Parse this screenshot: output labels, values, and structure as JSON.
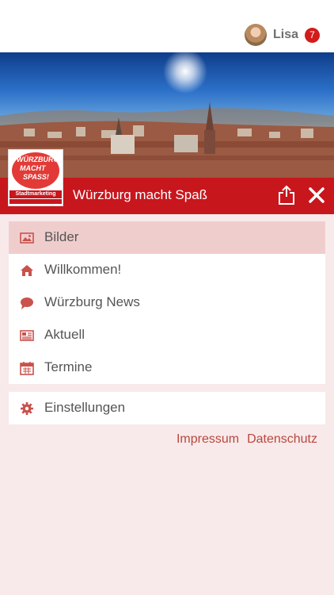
{
  "user": {
    "name": "Lisa",
    "notifications": "7"
  },
  "banner": {
    "title": "Würzburg macht Spaß"
  },
  "logo": {
    "lines": [
      "WÜRZBURG",
      "MACHT",
      "SPASS!"
    ],
    "strip": "Stadtmarketing"
  },
  "menu": {
    "items": [
      {
        "label": "Bilder",
        "icon": "image-icon",
        "active": true
      },
      {
        "label": "Willkommen!",
        "icon": "home-icon",
        "active": false
      },
      {
        "label": "Würzburg News",
        "icon": "speech-bubble-icon",
        "active": false
      },
      {
        "label": "Aktuell",
        "icon": "newspaper-icon",
        "active": false
      },
      {
        "label": "Termine",
        "icon": "calendar-icon",
        "active": false
      }
    ],
    "settings": {
      "label": "Einstellungen",
      "icon": "gear-icon"
    }
  },
  "footer": {
    "impressum": "Impressum",
    "datenschutz": "Datenschutz"
  },
  "colors": {
    "accent": "#c8161d",
    "icon": "#c9524c",
    "background": "#f8eaea",
    "active_row": "#f0cdcd"
  }
}
